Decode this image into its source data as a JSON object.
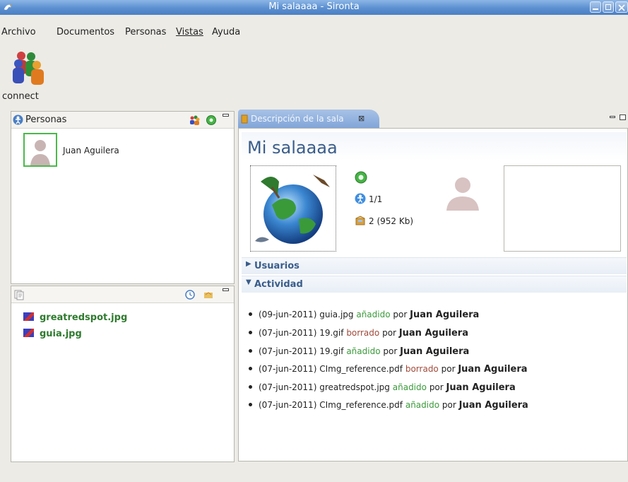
{
  "window": {
    "title": "Mi salaaaa - Sironta"
  },
  "menu": [
    "Archivo",
    "Documentos",
    "Personas",
    "Vistas",
    "Ayuda"
  ],
  "toolbar": {
    "connect_label": "connect"
  },
  "people_panel": {
    "title": "Personas",
    "people": [
      {
        "name": "Juan Aguilera"
      }
    ]
  },
  "files_panel": {
    "files": [
      "greatredspot.jpg",
      "guia.jpg"
    ]
  },
  "editor": {
    "tab_label": "Descripción de la sala",
    "room_title": "Mi salaaaa",
    "users_count": "1/1",
    "files_summary": "2 (952 Kb)",
    "sections": {
      "users": "Usuarios",
      "activity": "Actividad"
    },
    "activity": [
      {
        "date": "(09-jun-2011)",
        "file": "guia.jpg",
        "action": "añadido",
        "type": "added",
        "by": "por",
        "user": "Juan Aguilera"
      },
      {
        "date": "(07-jun-2011)",
        "file": "19.gif",
        "action": "borrado",
        "type": "deleted",
        "by": "por",
        "user": "Juan Aguilera"
      },
      {
        "date": "(07-jun-2011)",
        "file": "19.gif",
        "action": "añadido",
        "type": "added",
        "by": "por",
        "user": "Juan Aguilera"
      },
      {
        "date": "(07-jun-2011)",
        "file": "CImg_reference.pdf",
        "action": "borrado",
        "type": "deleted",
        "by": "por",
        "user": "Juan Aguilera"
      },
      {
        "date": "(07-jun-2011)",
        "file": "greatredspot.jpg",
        "action": "añadido",
        "type": "added",
        "by": "por",
        "user": "Juan Aguilera"
      },
      {
        "date": "(07-jun-2011)",
        "file": "CImg_reference.pdf",
        "action": "añadido",
        "type": "added",
        "by": "por",
        "user": "Juan Aguilera"
      }
    ]
  },
  "icons": {
    "app": "swan-icon",
    "connect": "people-connect-icon",
    "people_panel": "person-icon",
    "files_panel": "documents-icon",
    "online": "green-status-icon",
    "users": "users-icon",
    "files": "box-icon",
    "history": "clock-icon"
  },
  "colors": {
    "added": "#3a9a3a",
    "deleted": "#a04a3a",
    "title_blue": "#3a5d8a",
    "online_border": "#4bb84b"
  }
}
